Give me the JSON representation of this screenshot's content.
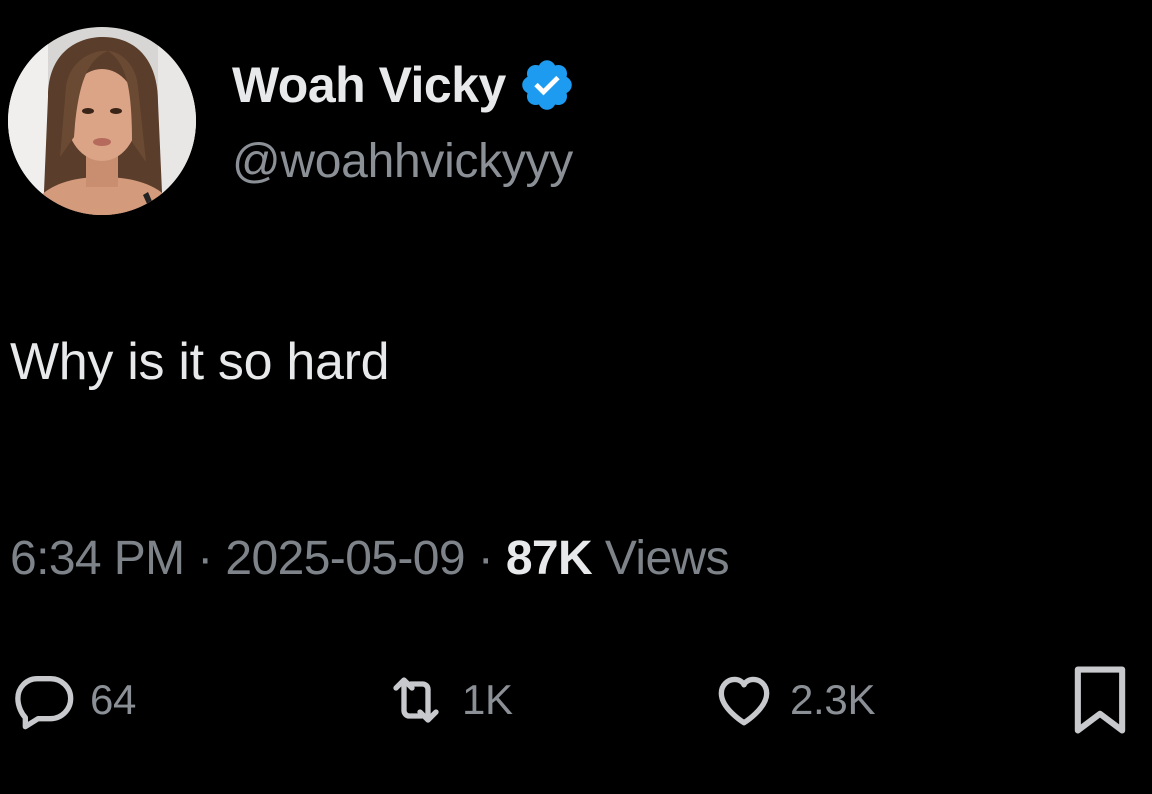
{
  "author": {
    "display_name": "Woah Vicky",
    "handle": "@woahhvickyyy",
    "verified_icon": "verified-badge-icon",
    "verified_color": "#1d9bf0"
  },
  "tweet": {
    "text": "Why is it so hard"
  },
  "meta": {
    "time": "6:34 PM",
    "separator": " · ",
    "date": "2025-05-09",
    "views_count": "87K",
    "views_label": " Views"
  },
  "actions": {
    "reply": {
      "icon": "reply-icon",
      "count": "64"
    },
    "retweet": {
      "icon": "retweet-icon",
      "count": "1K"
    },
    "like": {
      "icon": "heart-icon",
      "count": "2.3K"
    },
    "bookmark": {
      "icon": "bookmark-icon"
    }
  },
  "colors": {
    "background": "#000000",
    "primary_text": "#e7e9ea",
    "secondary_text": "#8b9096",
    "accent": "#1d9bf0"
  }
}
